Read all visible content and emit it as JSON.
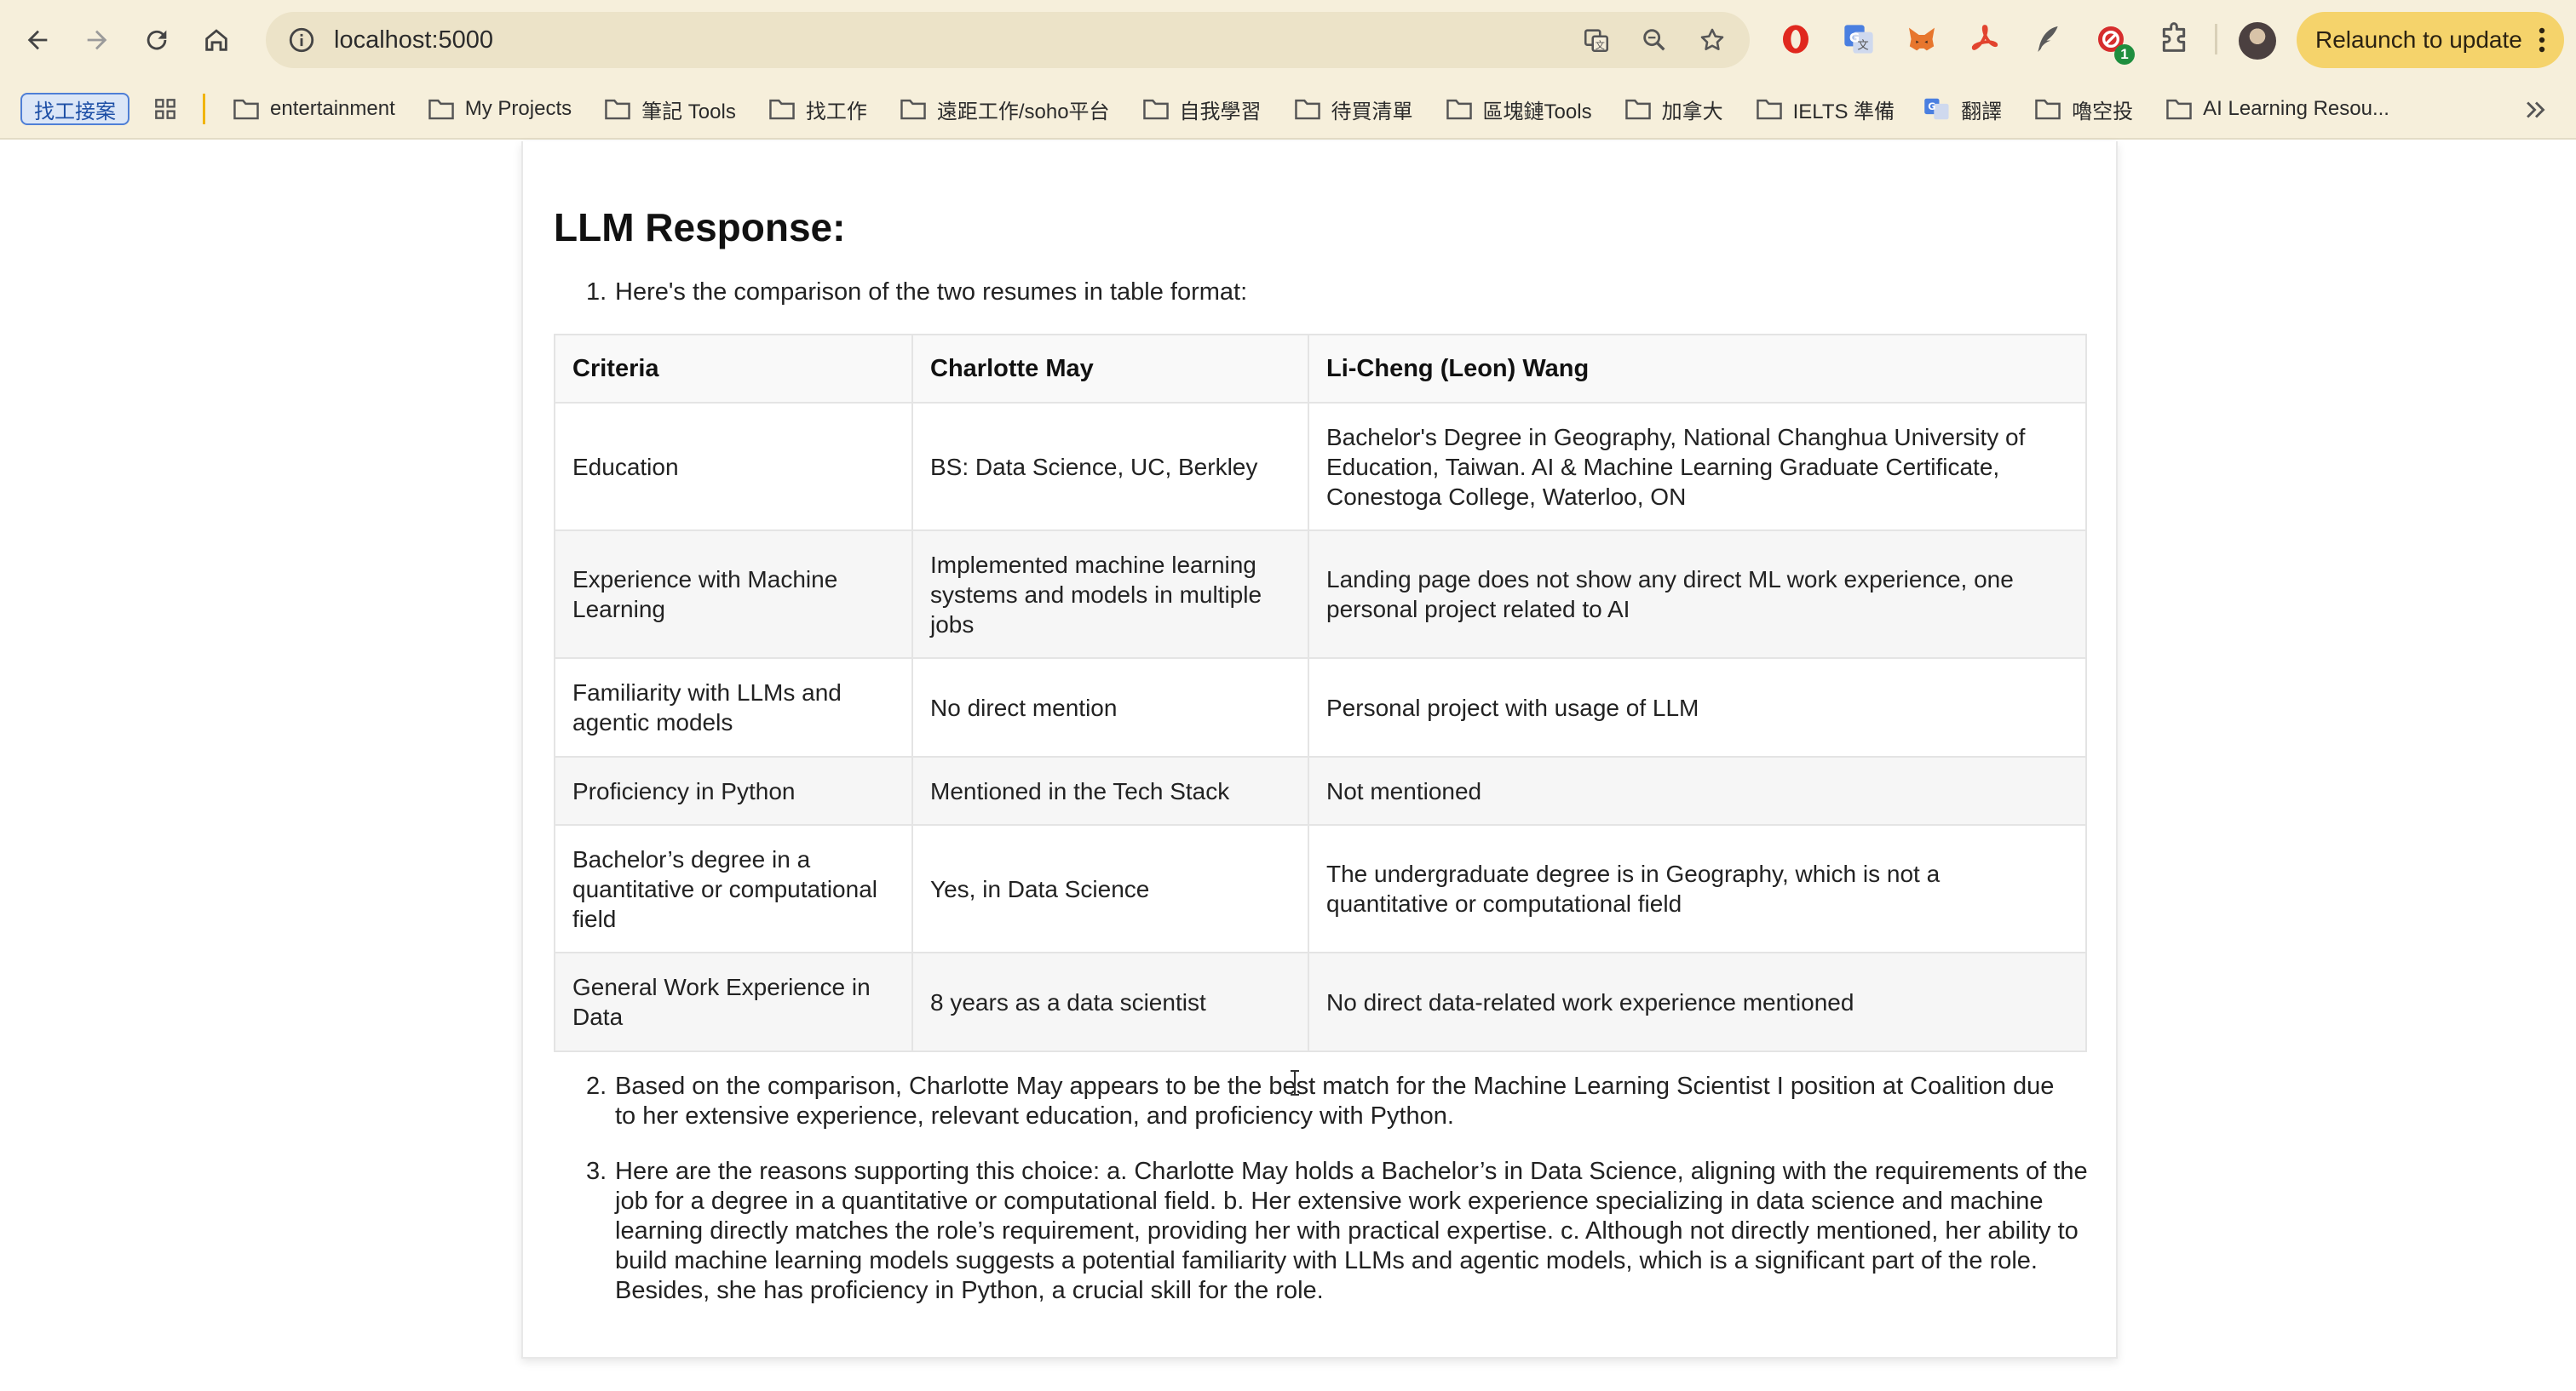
{
  "browser": {
    "url": "localhost:5000",
    "relaunch_label": "Relaunch to update",
    "extension_badge": "1"
  },
  "bookmarks": {
    "search_label": "找工接案",
    "items": [
      {
        "label": "entertainment"
      },
      {
        "label": "My Projects"
      },
      {
        "label": "筆記 Tools"
      },
      {
        "label": "找工作"
      },
      {
        "label": "遠距工作/soho平台"
      },
      {
        "label": "自我學習"
      },
      {
        "label": "待買清單"
      },
      {
        "label": "區塊鏈Tools"
      },
      {
        "label": "加拿大"
      },
      {
        "label": "IELTS 準備"
      },
      {
        "label": "翻譯"
      },
      {
        "label": "嚕空投"
      },
      {
        "label": "AI Learning Resou..."
      }
    ]
  },
  "page": {
    "title": "LLM Response:",
    "intro_number": "1.",
    "intro": "Here's the comparison of the two resumes in table format:",
    "table": {
      "headers": [
        "Criteria",
        "Charlotte May",
        "Li-Cheng (Leon) Wang"
      ],
      "rows": [
        [
          "Education",
          "BS: Data Science, UC, Berkley",
          "Bachelor's Degree in Geography, National Changhua University of Education, Taiwan. AI & Machine Learning Graduate Certificate, Conestoga College, Waterloo, ON"
        ],
        [
          "Experience with Machine Learning",
          "Implemented machine learning systems and models in multiple jobs",
          "Landing page does not show any direct ML work experience, one personal project related to AI"
        ],
        [
          "Familiarity with LLMs and agentic models",
          "No direct mention",
          "Personal project with usage of LLM"
        ],
        [
          "Proficiency in Python",
          "Mentioned in the Tech Stack",
          "Not mentioned"
        ],
        [
          "Bachelor’s degree in a quantitative or computational field",
          "Yes, in Data Science",
          "The undergraduate degree is in Geography, which is not a quantitative or computational field"
        ],
        [
          "General Work Experience in Data",
          "8 years as a data scientist",
          "No direct data-related work experience mentioned"
        ]
      ]
    },
    "item2_number": "2.",
    "item2": "Based on the comparison, Charlotte May appears to be the best match for the Machine Learning Scientist I position at Coalition due to her extensive experience, relevant education, and proficiency with Python.",
    "item3_number": "3.",
    "item3": "Here are the reasons supporting this choice: a. Charlotte May holds a Bachelor’s in Data Science, aligning with the requirements of the job for a degree in a quantitative or computational field. b. Her extensive work experience specializing in data science and machine learning directly matches the role’s requirement, providing her with practical expertise. c. Although not directly mentioned, her ability to build machine learning models suggests a potential familiarity with LLMs and agentic models, which is a significant part of the role. Besides, she has proficiency in Python, a crucial skill for the role."
  }
}
